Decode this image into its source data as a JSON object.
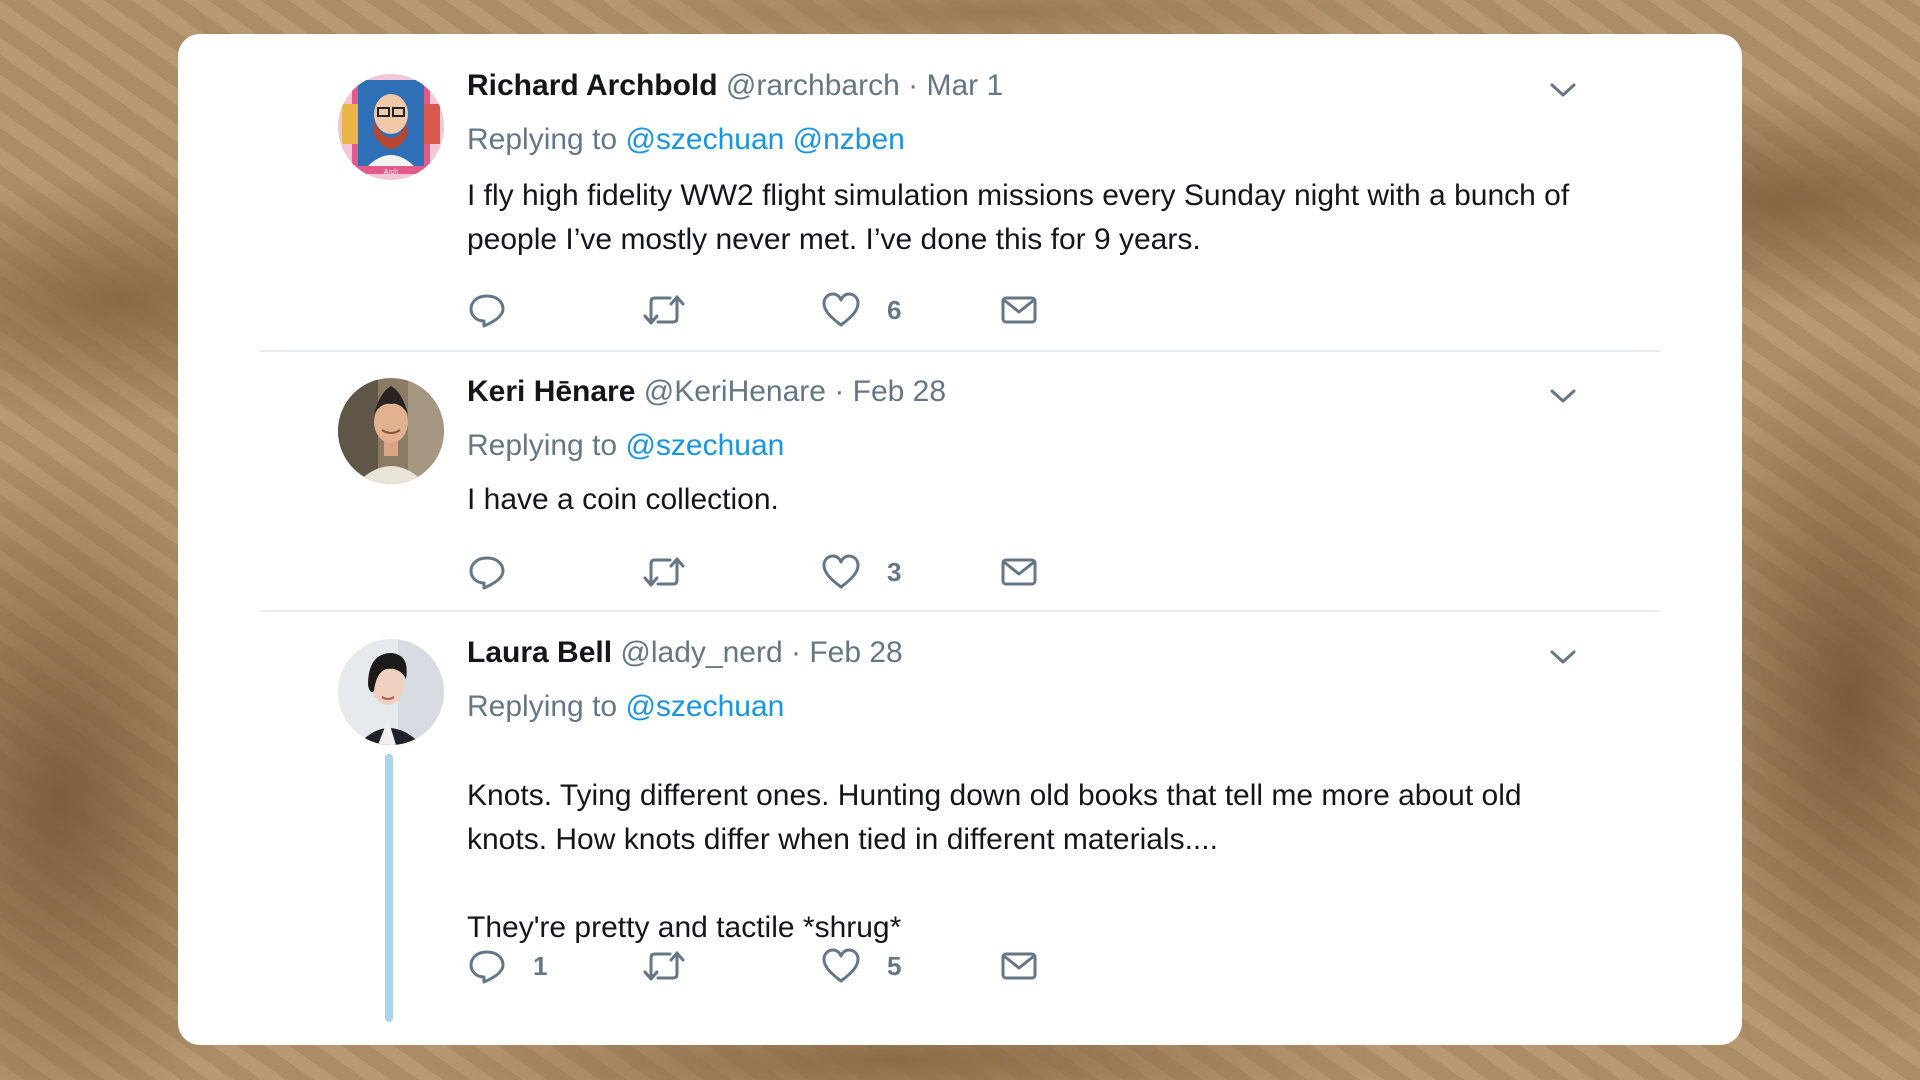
{
  "tweets": [
    {
      "name": "Richard Archbold",
      "handle": "@rarchbarch",
      "separator": "·",
      "date": "Mar 1",
      "replying_label": "Replying to",
      "mentions": [
        "@szechuan",
        "@nzben"
      ],
      "paragraphs": [
        "I fly high fidelity WW2 flight simulation missions every Sunday night with a bunch of people I’ve mostly never met. I’ve done this for 9 years."
      ],
      "avatar_caption": "Arch",
      "reply_count": "",
      "retweet_count": "",
      "like_count": "6"
    },
    {
      "name": "Keri Hēnare",
      "handle": "@KeriHenare",
      "separator": "·",
      "date": "Feb 28",
      "replying_label": "Replying to",
      "mentions": [
        "@szechuan"
      ],
      "paragraphs": [
        "I have a coin collection."
      ],
      "reply_count": "",
      "retweet_count": "",
      "like_count": "3"
    },
    {
      "name": "Laura Bell",
      "handle": "@lady_nerd",
      "separator": "·",
      "date": "Feb 28",
      "replying_label": "Replying to",
      "mentions": [
        "@szechuan"
      ],
      "paragraphs": [
        "Knots. Tying different ones. Hunting down old books that tell me more about old knots. How knots differ when tied in different materials....",
        "They're pretty and tactile *shrug*"
      ],
      "reply_count": "1",
      "retweet_count": "",
      "like_count": "5"
    }
  ],
  "colors": {
    "text": "#14171a",
    "secondary": "#657786",
    "link": "#1b95e0",
    "thread_line": "#a8d4ec",
    "divider": "#e6ecf0"
  },
  "icons": [
    "chevron-down-icon",
    "reply-icon",
    "retweet-icon",
    "like-icon",
    "direct-message-icon"
  ]
}
